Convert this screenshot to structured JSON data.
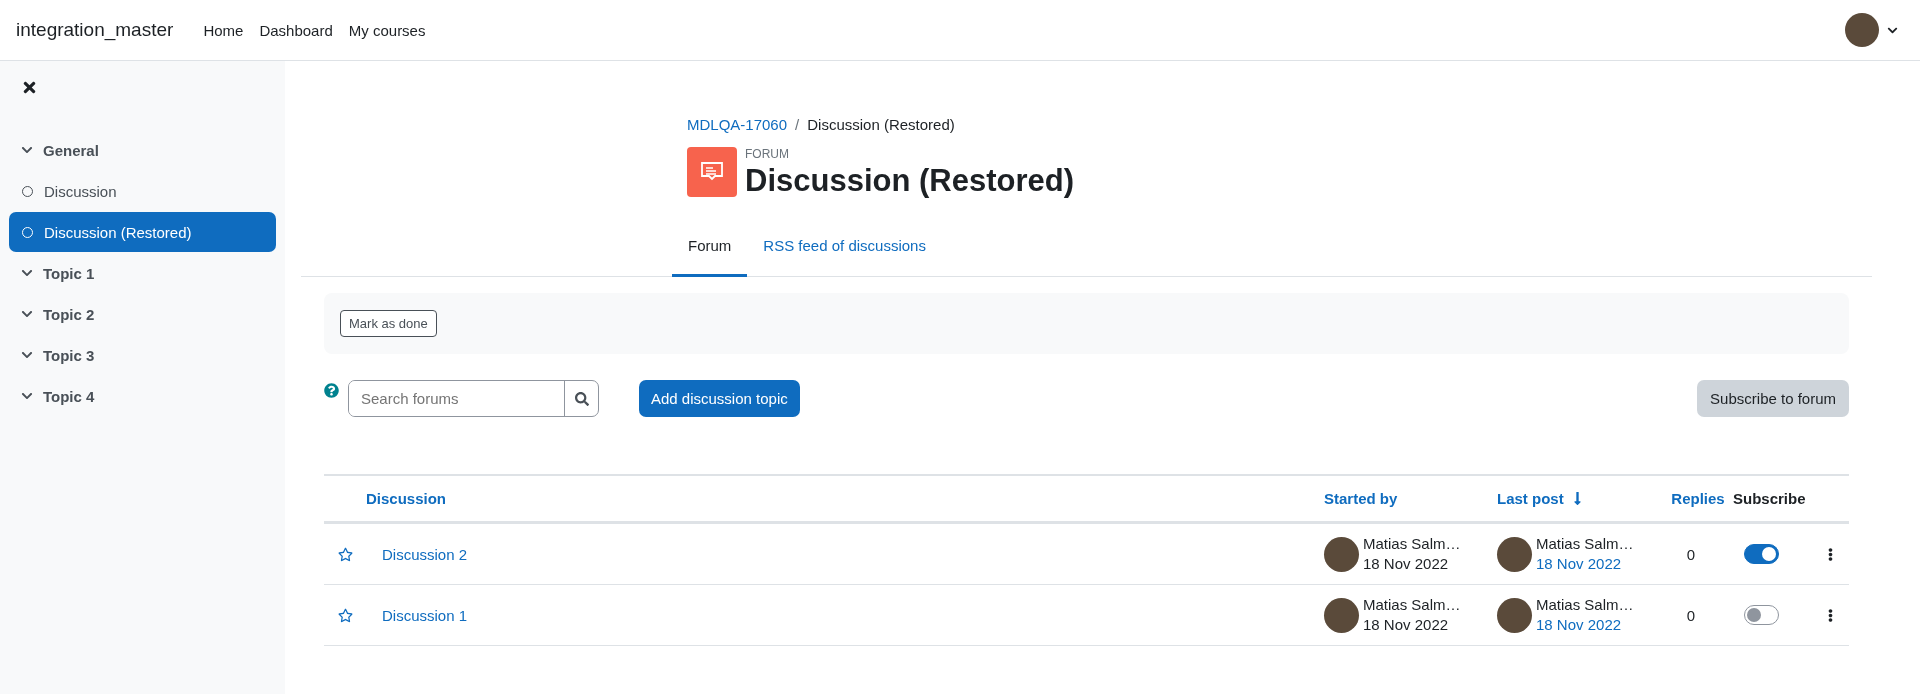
{
  "navbar": {
    "site_name": "integration_master",
    "links": [
      "Home",
      "Dashboard",
      "My courses"
    ]
  },
  "sidebar": {
    "items": [
      {
        "kind": "section",
        "label": "General",
        "expanded": true,
        "selected": false
      },
      {
        "kind": "activity",
        "label": "Discussion",
        "selected": false
      },
      {
        "kind": "activity",
        "label": "Discussion (Restored)",
        "selected": true
      },
      {
        "kind": "section",
        "label": "Topic 1",
        "expanded": true,
        "selected": false
      },
      {
        "kind": "section",
        "label": "Topic 2",
        "expanded": true,
        "selected": false
      },
      {
        "kind": "section",
        "label": "Topic 3",
        "expanded": true,
        "selected": false
      },
      {
        "kind": "section",
        "label": "Topic 4",
        "expanded": true,
        "selected": false
      }
    ]
  },
  "breadcrumb": {
    "items": [
      "MDLQA-17060",
      "Discussion (Restored)"
    ],
    "separator": "/"
  },
  "activity": {
    "type_label": "FORUM",
    "title": "Discussion (Restored)"
  },
  "tabs": [
    {
      "label": "Forum",
      "selected": true
    },
    {
      "label": "RSS feed of discussions",
      "selected": false
    }
  ],
  "completion": {
    "button": "Mark as done"
  },
  "search": {
    "placeholder": "Search forums"
  },
  "add_button": "Add discussion topic",
  "subscribe_button": "Subscribe to forum",
  "table": {
    "columns": [
      {
        "label": "Discussion",
        "sortable": true
      },
      {
        "label": "Started by",
        "sortable": true
      },
      {
        "label": "Last post",
        "sortable": true
      },
      {
        "label": "Replies",
        "sortable": true
      },
      {
        "label": "Subscribe",
        "sortable": false
      }
    ],
    "rows": [
      {
        "title": "Discussion 2",
        "starter": "Matias Salm…",
        "started": "18 Nov 2022",
        "last_author": "Matias Salm…",
        "last_date": "18 Nov 2022",
        "replies": "0",
        "subscribed": true
      },
      {
        "title": "Discussion 1",
        "starter": "Matias Salm…",
        "started": "18 Nov 2022",
        "last_author": "Matias Salm…",
        "last_date": "18 Nov 2022",
        "replies": "0",
        "subscribed": false
      }
    ]
  }
}
